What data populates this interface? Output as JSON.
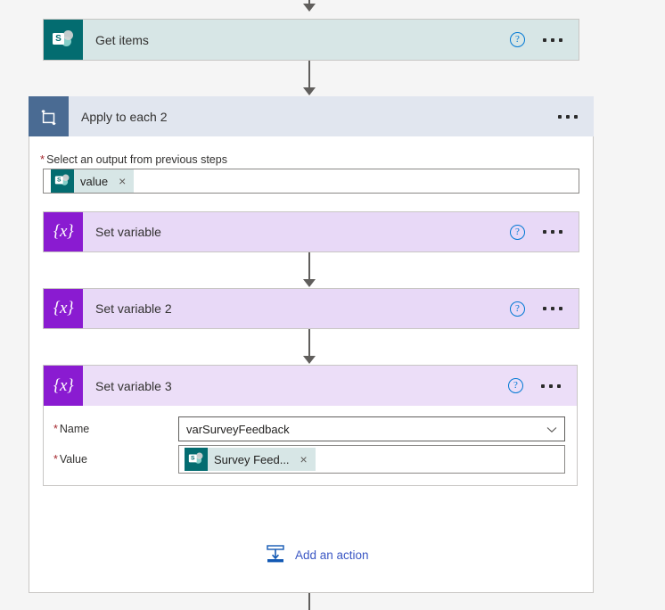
{
  "flow": {
    "steps": [
      {
        "id": "get-items",
        "title": "Get items",
        "icon": "sharepoint-icon",
        "help_icon": "?",
        "menu_icon": "ellipsis-icon",
        "accent": "#036c70",
        "background": "#d7e6e6"
      },
      {
        "id": "apply-to-each-2",
        "title": "Apply to each 2",
        "icon": "loop-icon",
        "menu_icon": "ellipsis-icon",
        "accent": "#4a6b93",
        "background": "#e1e6ef",
        "output_field": {
          "required_marker": "*",
          "label": "Select an output from previous steps",
          "token": {
            "icon": "sharepoint-icon",
            "label": "value",
            "remove_icon": "×"
          }
        }
      },
      {
        "id": "set-variable",
        "title": "Set variable",
        "icon": "variable-icon",
        "icon_glyph": "{x}",
        "help_icon": "?",
        "menu_icon": "ellipsis-icon",
        "accent": "#8a1bd1",
        "background": "#e8d9f7"
      },
      {
        "id": "set-variable-2",
        "title": "Set variable 2",
        "icon": "variable-icon",
        "icon_glyph": "{x}",
        "help_icon": "?",
        "menu_icon": "ellipsis-icon",
        "accent": "#8a1bd1",
        "background": "#e8d9f7"
      },
      {
        "id": "set-variable-3",
        "title": "Set variable 3",
        "icon": "variable-icon",
        "icon_glyph": "{x}",
        "help_icon": "?",
        "menu_icon": "ellipsis-icon",
        "accent": "#8a1bd1",
        "background": "#ecdef8",
        "expanded": true,
        "fields": [
          {
            "required_marker": "*",
            "label": "Name",
            "type": "combobox",
            "value": "varSurveyFeedback",
            "placeholder": "",
            "chevron_icon": "chevron-down-icon"
          },
          {
            "required_marker": "*",
            "label": "Value",
            "type": "token-input",
            "token": {
              "icon": "sharepoint-icon",
              "label": "Survey Feed...",
              "remove_icon": "×"
            }
          }
        ]
      }
    ],
    "add_action": {
      "label": "Add an action",
      "icon": "insert-step-icon",
      "color": "#3b57c4"
    }
  }
}
